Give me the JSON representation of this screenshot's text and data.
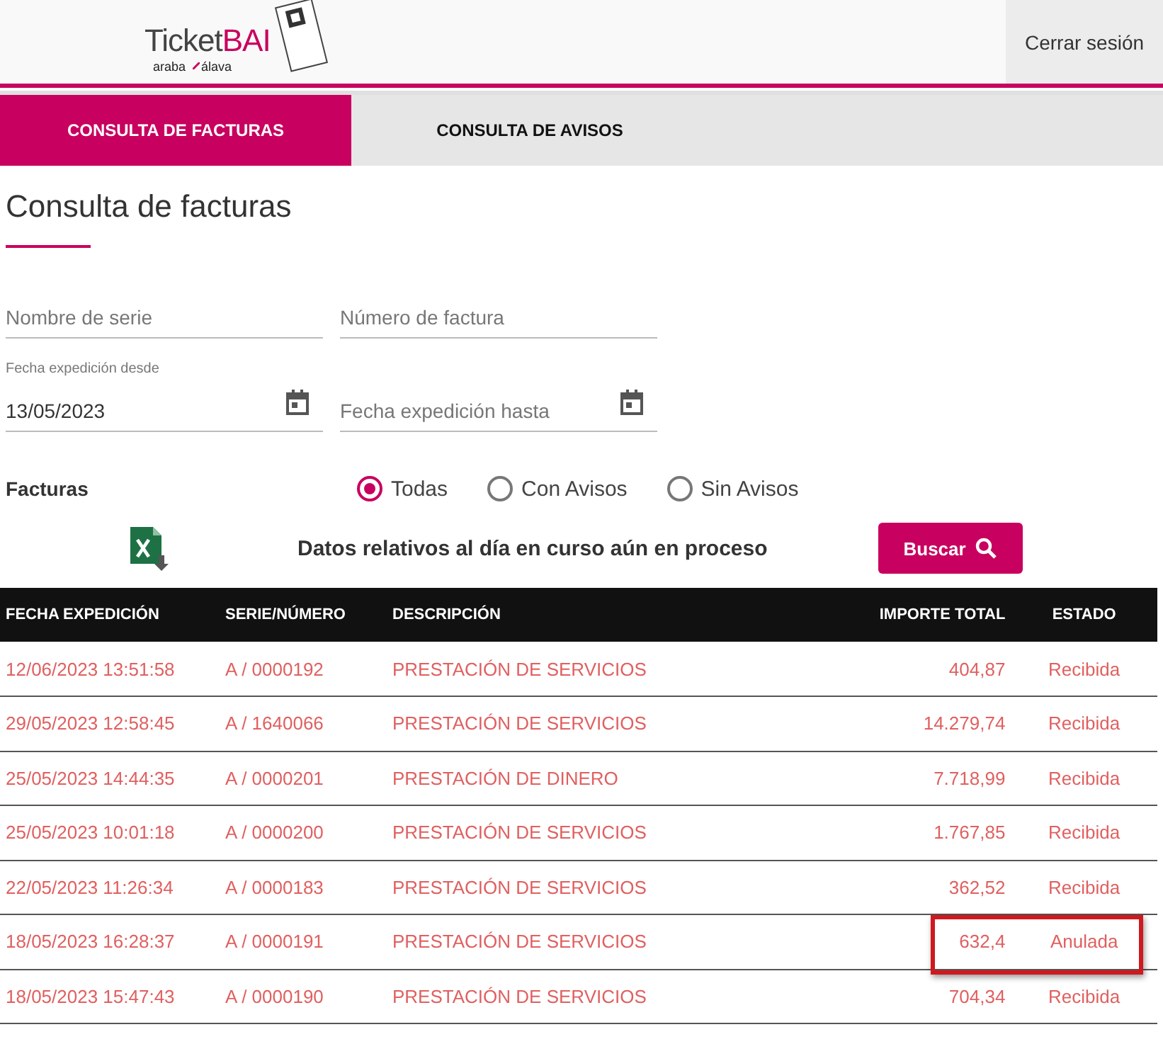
{
  "header": {
    "logo": {
      "word": "Ticket",
      "accent": "BAI",
      "subtitle_left": "araba",
      "subtitle_right": "álava"
    },
    "logout": "Cerrar sesión"
  },
  "tabs": [
    {
      "label": "CONSULTA DE FACTURAS",
      "selected": true
    },
    {
      "label": "CONSULTA DE AVISOS",
      "selected": false
    }
  ],
  "title": "Consulta de facturas",
  "filters": [
    {
      "placeholder": "Nombre de serie",
      "kind": "text"
    },
    {
      "placeholder": "Número de factura",
      "kind": "text"
    },
    {
      "label": "Fecha expedición desde",
      "value": "13/05/2023",
      "kind": "date"
    },
    {
      "placeholder": "Fecha expedición hasta",
      "kind": "date"
    }
  ],
  "invoice_filter": {
    "label": "Facturas",
    "options": [
      {
        "label": "Todas",
        "selected": true
      },
      {
        "label": "Con Avisos",
        "selected": false
      },
      {
        "label": "Sin Avisos",
        "selected": false
      }
    ]
  },
  "notice": "Datos relativos al día en curso aún en proceso",
  "search_button": "Buscar",
  "table": {
    "columns": [
      "FECHA EXPEDICIÓN",
      "SERIE/NÚMERO",
      "DESCRIPCIÓN",
      "IMPORTE TOTAL",
      "ESTADO"
    ],
    "rows": [
      {
        "cells": [
          "12/06/2023 13:51:58",
          "A / 0000192",
          "PRESTACIÓN DE SERVICIOS",
          "404,87",
          "Recibida"
        ],
        "highlighted": false
      },
      {
        "cells": [
          "29/05/2023 12:58:45",
          "A / 1640066",
          "PRESTACIÓN DE SERVICIOS",
          "14.279,74",
          "Recibida"
        ],
        "highlighted": false
      },
      {
        "cells": [
          "25/05/2023 14:44:35",
          "A / 0000201",
          "PRESTACIÓN DE DINERO",
          "7.718,99",
          "Recibida"
        ],
        "highlighted": false
      },
      {
        "cells": [
          "25/05/2023 10:01:18",
          "A / 0000200",
          "PRESTACIÓN DE SERVICIOS",
          "1.767,85",
          "Recibida"
        ],
        "highlighted": false
      },
      {
        "cells": [
          "22/05/2023 11:26:34",
          "A / 0000183",
          "PRESTACIÓN DE SERVICIOS",
          "362,52",
          "Recibida"
        ],
        "highlighted": false
      },
      {
        "cells": [
          "18/05/2023 16:28:37",
          "A / 0000191",
          "PRESTACIÓN DE SERVICIOS",
          "632,4",
          "Anulada"
        ],
        "highlighted": true
      },
      {
        "cells": [
          "18/05/2023 15:47:43",
          "A / 0000190",
          "PRESTACIÓN DE SERVICIOS",
          "704,34",
          "Recibida"
        ],
        "highlighted": false
      }
    ]
  }
}
